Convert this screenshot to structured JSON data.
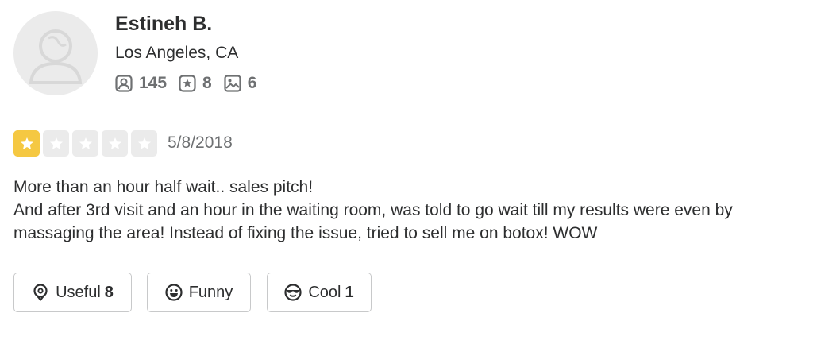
{
  "user": {
    "name": "Estineh B.",
    "location": "Los Angeles, CA",
    "avatar_icon": "default-user-avatar",
    "stats": {
      "friends": "145",
      "reviews": "8",
      "photos": "6"
    }
  },
  "review": {
    "rating": 1,
    "max_rating": 5,
    "date": "5/8/2018",
    "lines": [
      "More than an hour half wait.. sales pitch!",
      "And after 3rd visit and an hour in the waiting room, was told to go wait till my results were even by",
      "massaging the area!  Instead of fixing the issue, tried to sell me on botox! WOW"
    ]
  },
  "reactions": {
    "useful": {
      "label": "Useful",
      "count": "8",
      "icon": "lightbulb-icon"
    },
    "funny": {
      "label": "Funny",
      "count": "",
      "icon": "smiley-icon"
    },
    "cool": {
      "label": "Cool",
      "count": "1",
      "icon": "sunglasses-face-icon"
    }
  },
  "colors": {
    "star_filled": "#f5c842",
    "star_empty": "#ebebeb",
    "text": "#2d2e2f",
    "muted": "#6e7072",
    "border": "#c8c9ca"
  }
}
